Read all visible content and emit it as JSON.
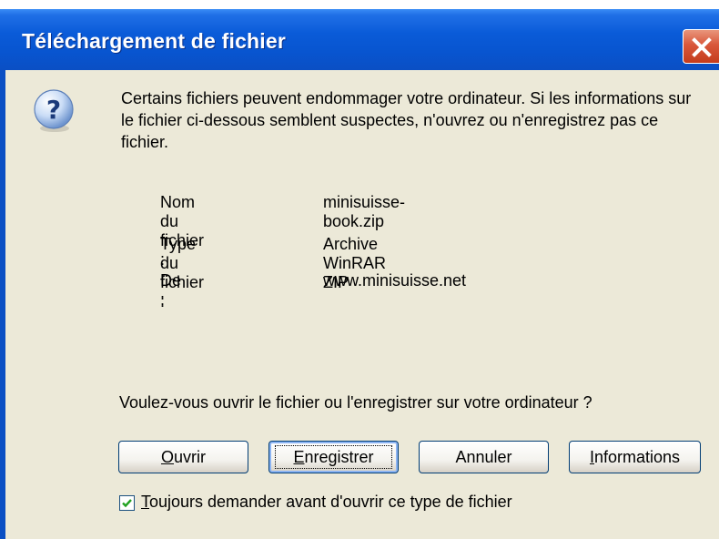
{
  "dialog": {
    "title": "Téléchargement de fichier",
    "close_icon": "close-icon",
    "question_icon": "question-icon",
    "message": "Certains fichiers peuvent endommager votre ordinateur. Si les informations sur le fichier ci-dessous semblent suspectes, n'ouvrez ou n'enregistrez pas ce fichier.",
    "details": [
      {
        "label": "Nom du fichier :",
        "value": "minisuisse-book.zip"
      },
      {
        "label": "Type du fichier :",
        "value": "Archive WinRAR ZIP"
      },
      {
        "label": "De :",
        "value": "www.minisuisse.net"
      }
    ],
    "question": "Voulez-vous ouvrir le fichier ou l'enregistrer sur votre ordinateur ?",
    "buttons": {
      "open": {
        "key": "O",
        "rest": "uvrir"
      },
      "save": {
        "key": "E",
        "rest": "nregistrer"
      },
      "cancel": {
        "label": "Annuler"
      },
      "info": {
        "key": "I",
        "rest": "nformations"
      }
    },
    "checkbox": {
      "checked": true,
      "key": "T",
      "rest": "oujours demander avant d'ouvrir ce type de fichier"
    }
  },
  "colors": {
    "titlebar": "#0855d0",
    "panel": "#ece9d8",
    "close": "#d8573b",
    "check": "#21a121"
  }
}
